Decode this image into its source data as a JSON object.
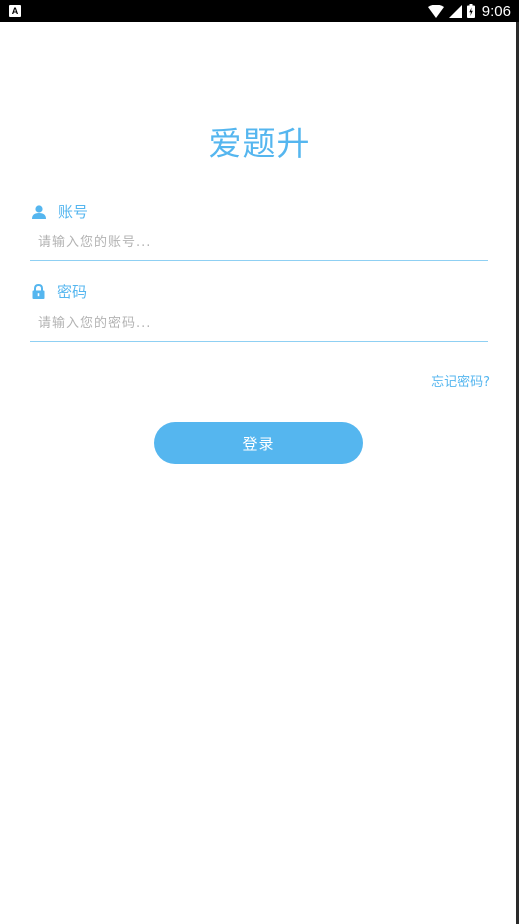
{
  "status_bar": {
    "notification_icon": "A",
    "time": "9:06",
    "icons": [
      "wifi-icon",
      "signal-icon",
      "battery-icon"
    ]
  },
  "app": {
    "title": "爱题升",
    "accent_color": "#55b6ef"
  },
  "account": {
    "icon": "user-icon",
    "label": "账号",
    "value": "",
    "placeholder": "请输入您的账号..."
  },
  "password": {
    "icon": "lock-icon",
    "label": "密码",
    "value": "",
    "placeholder": "请输入您的密码..."
  },
  "forgot_password": "忘记密码?",
  "login_button": "登录"
}
